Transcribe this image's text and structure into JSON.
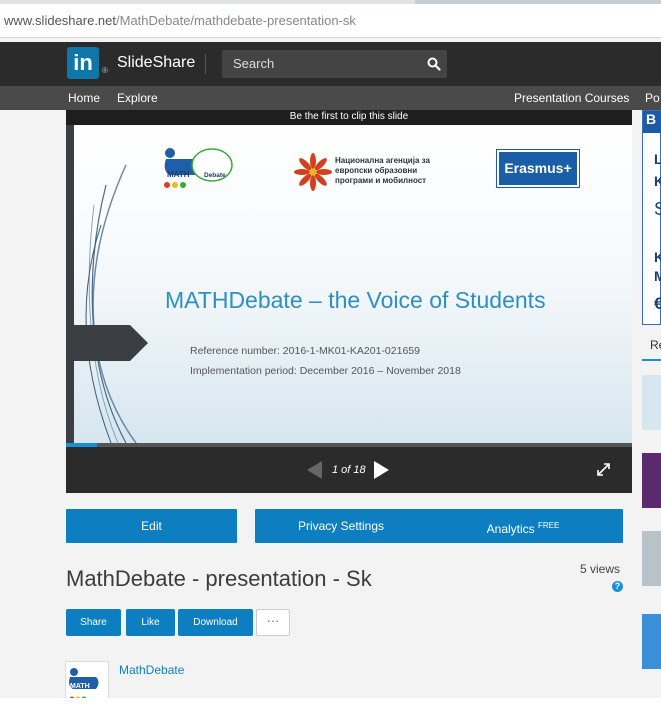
{
  "browser": {
    "url_host": "www.slideshare.net",
    "url_path": "/MathDebate/mathdebate-presentation-sk"
  },
  "header": {
    "logo": "in",
    "brand": "SlideShare",
    "search_placeholder": "Search"
  },
  "nav": {
    "items": [
      "Home",
      "Explore"
    ],
    "right_items": [
      "Presentation Courses",
      "Po"
    ]
  },
  "player": {
    "clip_banner": "Be the first to clip this slide",
    "slide": {
      "math_logo_text": "MATH",
      "math_logo_sub": "Debate",
      "agency_text": "Национална агенција за европски образовни програми и мобилност",
      "erasmus": "Erasmus+",
      "title": "MATHDebate – the Voice of Students",
      "reference": "Reference number: 2016-1-MK01-KA201-021659",
      "implementation": "Implementation period: December 2016 – November 2018"
    },
    "progress": 0.055,
    "page_indicator": "1 of 18"
  },
  "actions": {
    "edit": "Edit",
    "privacy": "Privacy Settings",
    "analytics": "Analytics",
    "analytics_badge": "FREE"
  },
  "presentation": {
    "title": "MathDebate - presentation - Sk",
    "views": "5 views",
    "help": "?",
    "share": "Share",
    "like": "Like",
    "download": "Download",
    "more": "···",
    "author": "MathDebate"
  },
  "sidebar": {
    "ad_top": "B",
    "ad_lines": [
      "L",
      "K",
      "S",
      "K",
      "M",
      "€"
    ],
    "tab_label": "Re"
  },
  "colors": {
    "accent": "#0d7fc1",
    "header": "#2b2b2b",
    "nav": "#4a4a4a",
    "title_blue": "#2e8fc0"
  }
}
